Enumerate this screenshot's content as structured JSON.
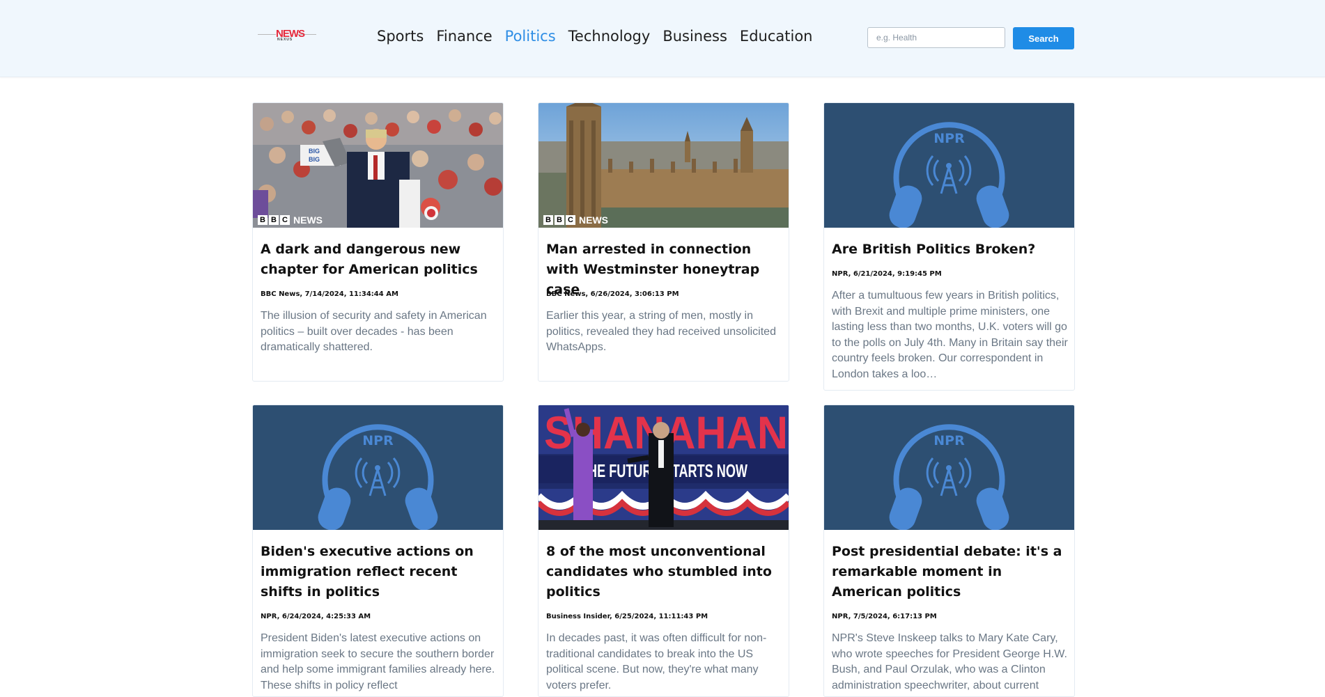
{
  "header": {
    "logo_text": "NEWS",
    "logo_sub": "NEXUS",
    "nav": [
      "Sports",
      "Finance",
      "Politics",
      "Technology",
      "Business",
      "Education"
    ],
    "active_nav": "Politics",
    "search_placeholder": "e.g. Health",
    "search_button": "Search"
  },
  "colors": {
    "accent": "#1f8ce6",
    "header_bg": "#f0f7fd",
    "npr_bg": "#2d4f72",
    "npr_icon": "#4a88d4"
  },
  "articles": [
    {
      "title": "A dark and dangerous new chapter for American politics",
      "meta": "BBC News, 7/14/2024, 11:34:44 AM",
      "description": "The illusion of security and safety in American politics – built over decades - has been dramatically shattered.",
      "image": "rally-photo",
      "badge": [
        "B",
        "B",
        "C",
        "NEWS"
      ]
    },
    {
      "title": "Man arrested in connection with Westminster honeytrap case",
      "meta": "BBC News, 6/26/2024, 3:06:13 PM",
      "description": "Earlier this year, a string of men, mostly in politics, revealed they had received unsolicited WhatsApps.",
      "image": "westminster-photo",
      "badge": [
        "B",
        "B",
        "C",
        "NEWS"
      ]
    },
    {
      "title": "Are British Politics Broken?",
      "meta": "NPR, 6/21/2024, 9:19:45 PM",
      "description": "After a tumultuous few years in British politics, with Brexit and multiple prime ministers, one lasting less than two months, U.K. voters will go to the polls on July 4th. Many in Britain say their country feels broken. Our correspondent in London takes a loo…",
      "image": "npr-logo",
      "logo_text": "NPR"
    },
    {
      "title": "Biden's executive actions on immigration reflect recent shifts in politics",
      "meta": "NPR, 6/24/2024, 4:25:33 AM",
      "description": "President Biden's latest executive actions on immigration seek to secure the southern border and help some immigrant families already here. These shifts in policy reflect",
      "image": "npr-logo",
      "logo_text": "NPR"
    },
    {
      "title": "8 of the most unconventional candidates who stumbled into politics",
      "meta": "Business Insider, 6/25/2024, 11:11:43 PM",
      "description": "In decades past, it was often difficult for non-traditional candidates to break into the US political scene. But now, they're what many voters prefer.",
      "image": "campaign-stage-photo",
      "banner_text": "SHANAHAN",
      "banner_sub": "THE FUTURE STARTS NOW"
    },
    {
      "title": "Post presidential debate: it's a remarkable moment in American politics",
      "meta": "NPR, 7/5/2024, 6:17:13 PM",
      "description": "NPR's Steve Inskeep talks to Mary Kate Cary, who wrote speeches for President George H.W. Bush, and Paul Orzulak, who was a Clinton administration speechwriter, about current",
      "image": "npr-logo",
      "logo_text": "NPR"
    }
  ]
}
